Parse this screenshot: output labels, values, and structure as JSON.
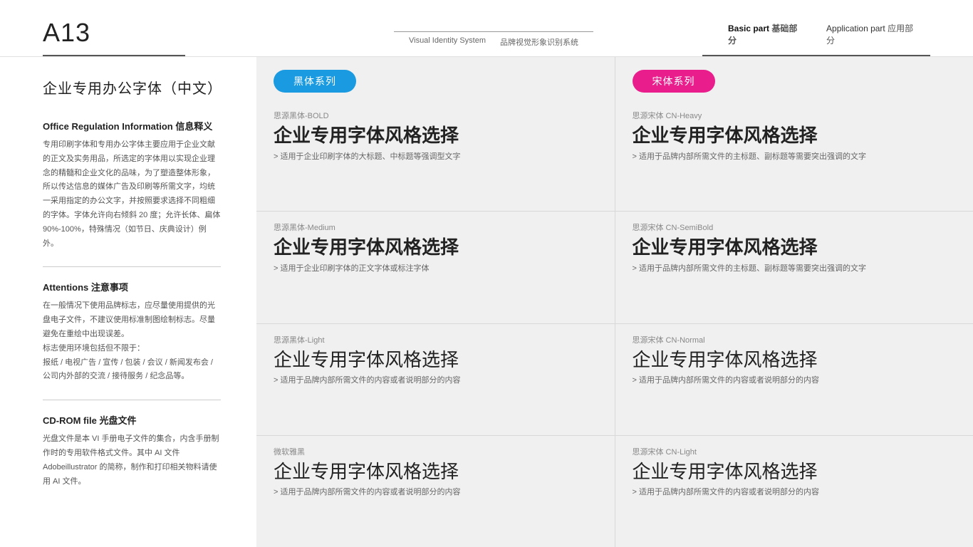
{
  "header": {
    "page_code": "A13",
    "center_line_visible": true,
    "center_title_en": "Visual Identity System",
    "center_title_cn": "品牌视觉形象识别系统",
    "right_items": [
      {
        "en": "Basic part",
        "cn": "基础部分",
        "active": true
      },
      {
        "en": "Application part",
        "cn": "应用部分",
        "active": false
      }
    ]
  },
  "sidebar": {
    "title": "企业专用办公字体（中文）",
    "sections": [
      {
        "title": "Office Regulation Information 信息释义",
        "body": "专用印刷字体和专用办公字体主要应用于企业文献的正文及实务用品，所选定的字体用以实现企业理念的精髓和企业文化的品味，为了塑造整体形象，所以传达信息的媒体广告及印刷等所需文字，均统一采用指定的办公文字，并按照要求选择不同粗细的字体。字体允许向右倾斜 20 度；允许长体、扁体 90%-100%，特殊情况（如节日、庆典设计）例外。"
      },
      {
        "divider": true
      },
      {
        "title": "Attentions 注意事项",
        "body": "在一般情况下使用品牌标志，应尽量使用提供的光盘电子文件，不建议使用标准制图绘制标志。尽量避免在重绘中出现误差。\n标志使用环境包括但不限于：\n报纸 / 电视广告 / 宣传 / 包装 / 会议 / 新闻发布会 / 公司内外部的交流 / 接待服务 / 纪念品等。"
      },
      {
        "divider": true
      },
      {
        "title": "CD-ROM file 光盘文件",
        "body": "光盘文件是本 VI 手册电子文件的集合，内含手册制作时的专用软件格式文件。其中 AI 文件 Adobeillustrator 的简称，制作和打印相关物料请使用 AI 文件。"
      }
    ]
  },
  "content": {
    "left_col": {
      "badge_label": "黑体系列",
      "badge_class": "badge-blue",
      "entries": [
        {
          "name": "思源黑体-BOLD",
          "sample": "企业专用字体风格选择",
          "sample_weight": "bold",
          "desc": "适用于企业印刷字体的大标题、中标题等强调型文字"
        },
        {
          "name": "思源黑体-Medium",
          "sample": "企业专用字体风格选择",
          "sample_weight": "medium",
          "desc": "适用于企业印刷字体的正文字体或标注字体"
        },
        {
          "name": "思源黑体-Light",
          "sample": "企业专用字体风格选择",
          "sample_weight": "light",
          "desc": "适用于品牌内部所需文件的内容或者说明部分的内容"
        },
        {
          "name": "微软雅黑",
          "sample": "企业专用字体风格选择",
          "sample_weight": "weibo",
          "desc": "适用于品牌内部所需文件的内容或者说明部分的内容"
        }
      ]
    },
    "right_col": {
      "badge_label": "宋体系列",
      "badge_class": "badge-pink",
      "entries": [
        {
          "name": "思源宋体 CN-Heavy",
          "sample": "企业专用字体风格选择",
          "sample_weight": "bold",
          "desc": "适用于品牌内部所需文件的主标题、副标题等需要突出强调的文字"
        },
        {
          "name": "思源宋体 CN-SemiBold",
          "sample": "企业专用字体风格选择",
          "sample_weight": "medium",
          "desc": "适用于品牌内部所需文件的主标题、副标题等需要突出强调的文字"
        },
        {
          "name": "思源宋体 CN-Normal",
          "sample": "企业专用字体风格选择",
          "sample_weight": "light",
          "desc": "适用于品牌内部所需文件的内容或者说明部分的内容"
        },
        {
          "name": "思源宋体 CN-Light",
          "sample": "企业专用字体风格选择",
          "sample_weight": "weibo",
          "desc": "适用于品牌内部所需文件的内容或者说明部分的内容"
        }
      ]
    }
  }
}
